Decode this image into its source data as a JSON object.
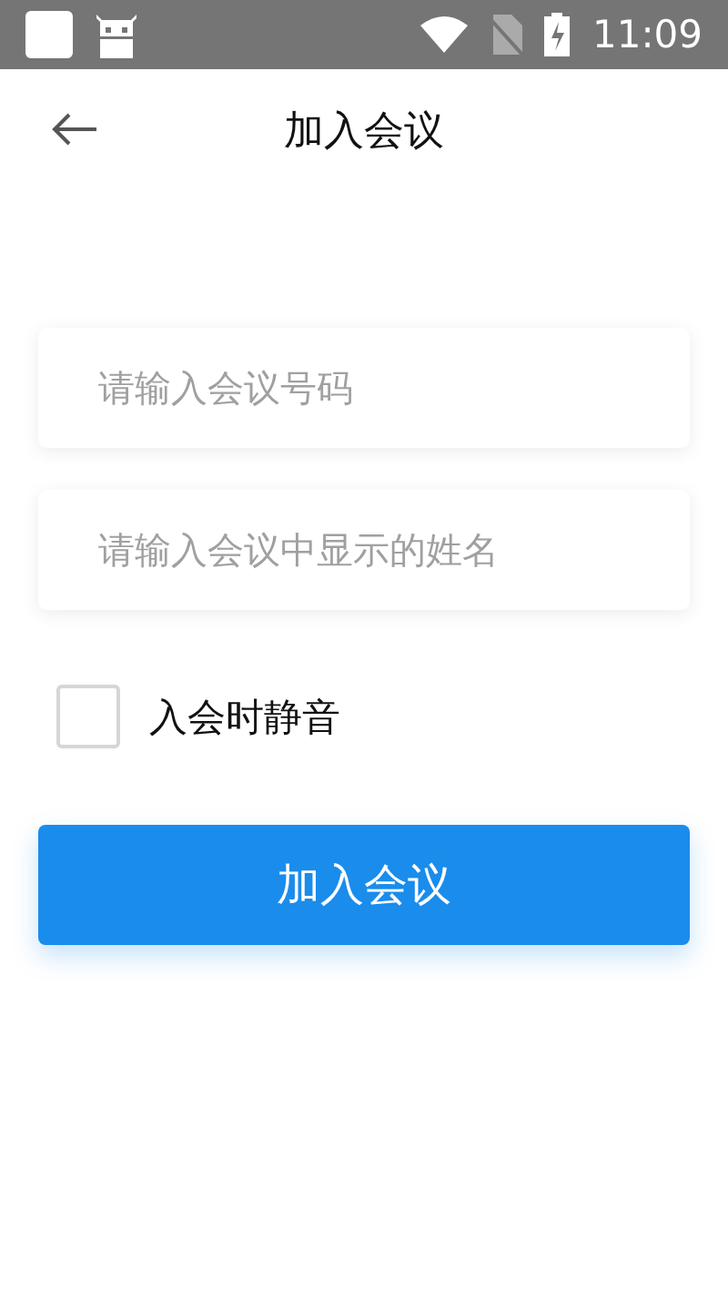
{
  "status_bar": {
    "time": "11:09"
  },
  "header": {
    "title": "加入会议"
  },
  "fields": [
    {
      "placeholder": "请输入会议号码"
    },
    {
      "placeholder": "请输入会议中显示的姓名"
    }
  ],
  "mute_option": {
    "label": "入会时静音",
    "checked": false
  },
  "join_button": {
    "label": "加入会议"
  }
}
